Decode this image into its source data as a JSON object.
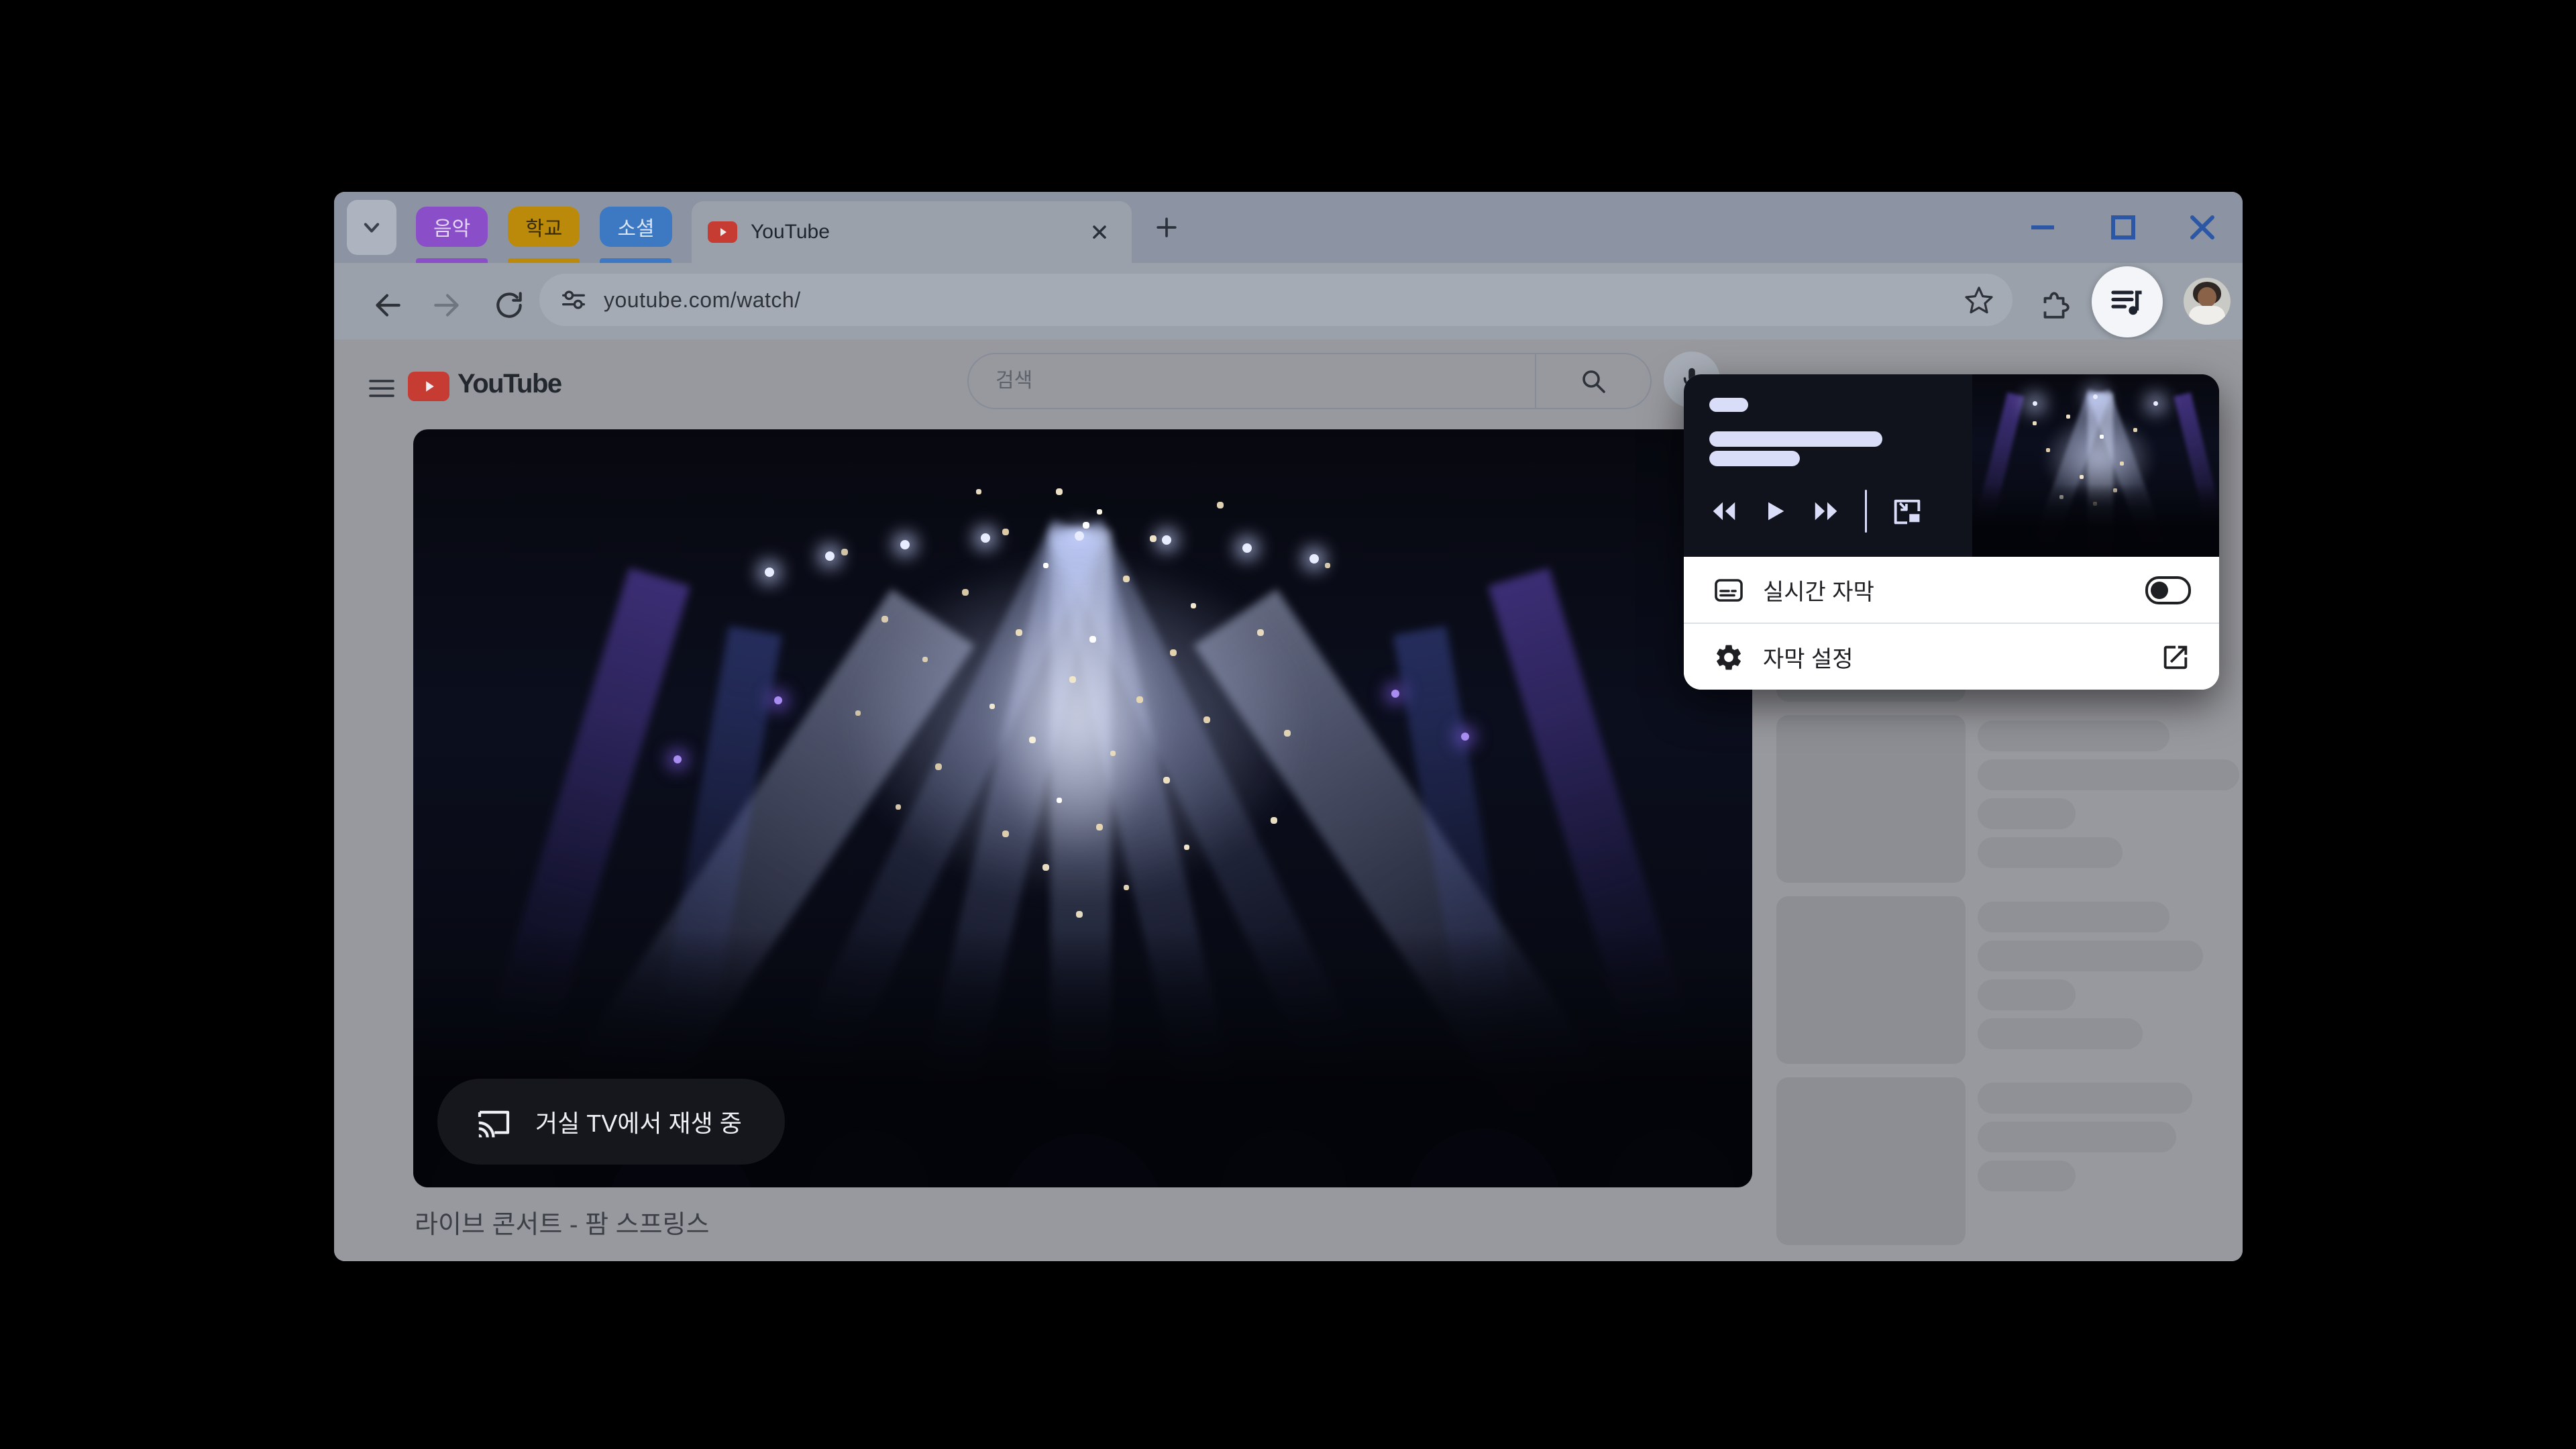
{
  "tab_strip": {
    "groups": [
      {
        "label": "음악",
        "bg": "#8a4fc8",
        "fg": "#e5d6f8"
      },
      {
        "label": "학교",
        "bg": "#bb8a0b",
        "fg": "#352b06"
      },
      {
        "label": "소셜",
        "bg": "#3d78c2",
        "fg": "#d9e6f8"
      }
    ],
    "active_tab": {
      "title": "YouTube",
      "favicon_color": "#c63b32"
    }
  },
  "window_controls": {
    "color": "#2b57a5"
  },
  "toolbar": {
    "url": "youtube.com/watch/"
  },
  "page": {
    "header": {
      "logo_text": "YouTube",
      "logo_color": "#c23b31",
      "search_placeholder": "검색"
    },
    "video": {
      "cast_status": "거실 TV에서 재생 중",
      "title": "라이브 콘서트 - 팜 스프링스"
    },
    "sidebar_skeleton_rows": [
      {
        "lines": []
      },
      {
        "lines": [
          286,
          390,
          146,
          216
        ]
      },
      {
        "lines": [
          286,
          336,
          146,
          246
        ]
      },
      {
        "lines": [
          320,
          296,
          146
        ]
      }
    ]
  },
  "media_popup": {
    "accent_pill_color": "#d9ddf8",
    "live_caption": {
      "label": "실시간 자막",
      "toggle_state": "off"
    },
    "caption_settings": {
      "label": "자막 설정"
    }
  }
}
